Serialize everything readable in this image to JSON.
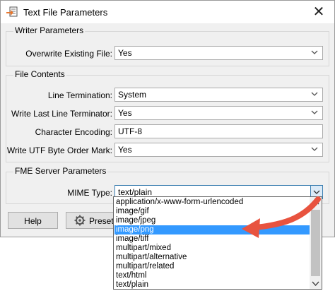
{
  "window": {
    "title": "Text File Parameters",
    "close_glyph": "✕"
  },
  "groups": {
    "writer": {
      "legend": "Writer Parameters",
      "overwrite_label": "Overwrite Existing File:",
      "overwrite_value": "Yes"
    },
    "file_contents": {
      "legend": "File Contents",
      "line_termination_label": "Line Termination:",
      "line_termination_value": "System",
      "last_line_label": "Write Last Line Terminator:",
      "last_line_value": "Yes",
      "encoding_label": "Character Encoding:",
      "encoding_value": "UTF-8",
      "bom_label": "Write UTF Byte Order Mark:",
      "bom_value": "Yes"
    },
    "fme_server": {
      "legend": "FME Server Parameters",
      "mime_label": "MIME Type:",
      "mime_value": "text/plain"
    }
  },
  "footer": {
    "help_label": "Help",
    "presets_label": "Presets"
  },
  "mime_options": [
    "application/x-www-form-urlencoded",
    "image/gif",
    "image/jpeg",
    "image/png",
    "image/tiff",
    "multipart/mixed",
    "multipart/alternative",
    "multipart/related",
    "text/html",
    "text/plain"
  ],
  "mime_highlighted": "image/png",
  "colors": {
    "selection": "#3399ff",
    "annotation_arrow": "#e8533f",
    "dialog_bg": "#f0f0f0"
  }
}
